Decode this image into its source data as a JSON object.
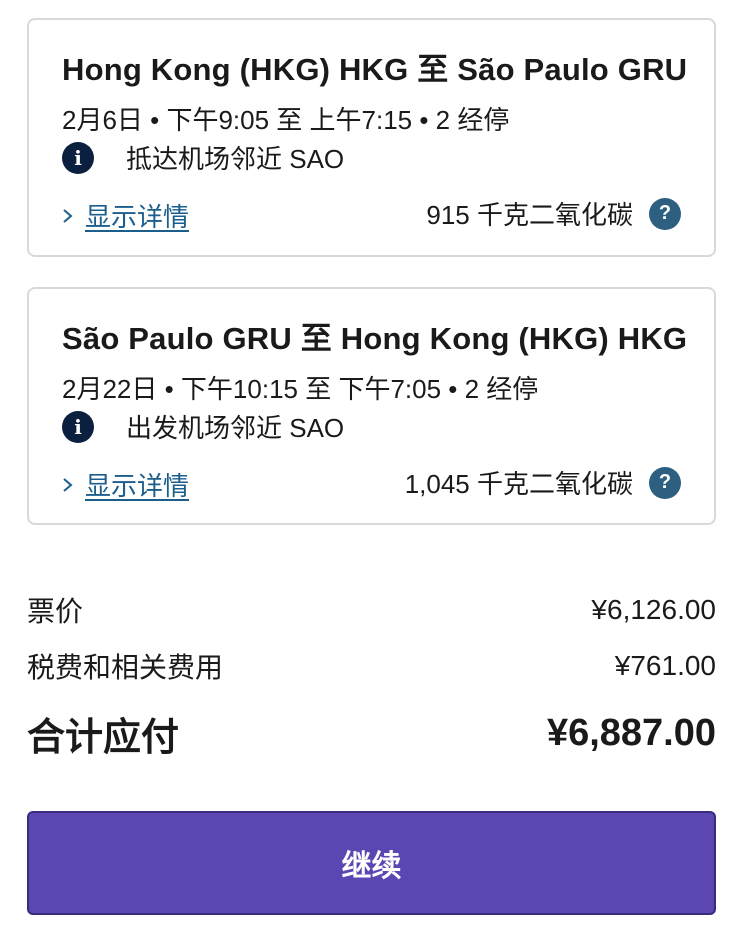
{
  "flights": [
    {
      "route": "Hong Kong (HKG) HKG 至 São Paulo GRU",
      "times": "2月6日 • 下午9:05 至 上午7:15 • 2 经停",
      "info_icon": "info-icon",
      "airport_note": "抵达机场邻近 SAO",
      "details_label": "显示详情",
      "co2": "915 千克二氧化碳",
      "help_icon": "question-icon",
      "help_symbol": "?"
    },
    {
      "route": "São Paulo GRU 至 Hong Kong (HKG) HKG",
      "times": "2月22日 • 下午10:15 至 下午7:05 • 2 经停",
      "info_icon": "info-icon",
      "airport_note": "出发机场邻近 SAO",
      "details_label": "显示详情",
      "co2": "1,045 千克二氧化碳",
      "help_icon": "question-icon",
      "help_symbol": "?"
    }
  ],
  "pricing": {
    "fare_label": "票价",
    "fare_value": "¥6,126.00",
    "taxes_label": "税费和相关费用",
    "taxes_value": "¥761.00",
    "total_label": "合计应付",
    "total_value": "¥6,887.00"
  },
  "continue_label": "继续",
  "colors": {
    "button": "#5c46b2",
    "link": "#1b5e8c",
    "info_icon": "#0b1f3f",
    "help_icon": "#2c5f80",
    "card_border": "#d9d9d9"
  }
}
